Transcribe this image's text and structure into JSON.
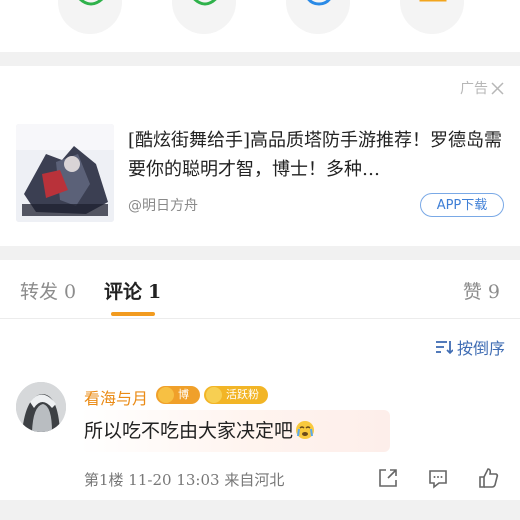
{
  "share": {
    "icons": [
      "wechat-icon",
      "moments-icon",
      "qq-icon",
      "save-image-icon"
    ]
  },
  "ad": {
    "label": "广告",
    "title": "[酷炫街舞给手]高品质塔防手游推荐！罗德岛需要你的聪明才智，博士！多种…",
    "source": "@明日方舟",
    "button": "APP下载"
  },
  "tabs": {
    "repost_label": "转发",
    "repost_count": "0",
    "comment_label": "评论",
    "comment_count": "1",
    "like_label": "赞",
    "like_count": "9"
  },
  "sort": {
    "label": "按倒序"
  },
  "comment": {
    "username": "看海与月",
    "badges": {
      "author": "博主",
      "fan": "活跃粉丝"
    },
    "text": "所以吃不吃由大家决定吧",
    "meta": "第1楼  11-20 13:03  来自河北"
  },
  "colors": {
    "accent": "#f29b1f",
    "username": "#ea8b16",
    "link_blue": "#3f6cb3"
  }
}
